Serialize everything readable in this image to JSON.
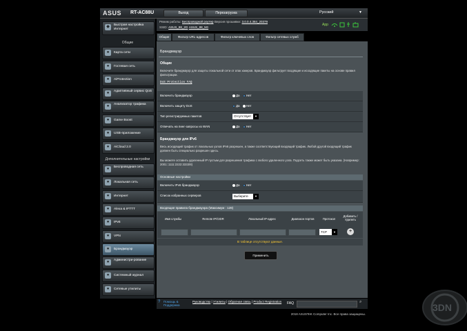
{
  "header": {
    "brand": "ASUS",
    "model": "RT-AC88U",
    "logout_label": "Выход",
    "reboot_label": "Перезагрузка",
    "language": "Русский"
  },
  "info": {
    "mode_label": "Режим работы:",
    "mode_value": "Беспроводной роутер",
    "firmware_label": "Версия прошивки:",
    "firmware_value": "3.0.0.4.384_20379",
    "ssid_label": "SSID:",
    "ssid_1": "ASUS_88_2G",
    "ssid_2": "ASUS_88_5G",
    "app_label": "App"
  },
  "sidebar": {
    "quick_setup": "Быстрая настройка Интернет",
    "general_heading": "Общие",
    "general_items": [
      {
        "label": "Карта сети",
        "icon": "network-map-icon"
      },
      {
        "label": "Гостевая сеть",
        "icon": "guest-network-icon"
      },
      {
        "label": "AiProtection",
        "icon": "aiprotection-icon"
      },
      {
        "label": "Адаптивный сервис QoS",
        "icon": "qos-icon"
      },
      {
        "label": "Анализатор трафика",
        "icon": "traffic-analyzer-icon"
      },
      {
        "label": "Game Boost",
        "icon": "game-boost-icon"
      },
      {
        "label": "USB-приложение",
        "icon": "usb-icon"
      },
      {
        "label": "AiCloud 2.0",
        "icon": "cloud-icon"
      }
    ],
    "advanced_heading": "Дополнительные настройки",
    "advanced_items": [
      {
        "label": "Беспроводная сеть",
        "icon": "wireless-icon"
      },
      {
        "label": "Локальная сеть",
        "icon": "lan-icon"
      },
      {
        "label": "Интернет",
        "icon": "wan-icon"
      },
      {
        "label": "Alexa & IFTTT",
        "icon": "alexa-icon"
      },
      {
        "label": "IPv6",
        "icon": "ipv6-icon"
      },
      {
        "label": "VPN",
        "icon": "vpn-icon"
      },
      {
        "label": "Брандмауэр",
        "icon": "firewall-icon",
        "active": true
      },
      {
        "label": "Администри-рование",
        "icon": "admin-icon"
      },
      {
        "label": "Системный журнал",
        "icon": "syslog-icon"
      },
      {
        "label": "Сетевые утилиты",
        "icon": "network-tools-icon"
      }
    ]
  },
  "tabs": [
    "Общие",
    "Фильтр URL-адресов",
    "Фильтр ключевых слов",
    "Фильтр сетевых служб"
  ],
  "main": {
    "title": "Брандмауэр",
    "general_heading": "Общие",
    "intro": "Включите брандмауэр для защиты локальной сети от атак хакеров. Брандмауэр фильтрует входящие и исходящие пакеты на основе правил фильтрации.",
    "dos_faq": "DoS Protection FAQ",
    "rows": [
      {
        "label": "Включить брандмауэр",
        "type": "radio",
        "yes": "Да",
        "no": "Нет",
        "selected": "no"
      },
      {
        "label": "Включить защиту DoS",
        "type": "radio",
        "yes": "Да",
        "no": "Нет",
        "selected": "yes"
      },
      {
        "label": "Тип регистрируемых пакетов",
        "type": "select",
        "value": "Отсутствует"
      },
      {
        "label": "Отвечать на пинг-запросы из WAN",
        "type": "radio",
        "yes": "Да",
        "no": "Нет",
        "selected": "no"
      }
    ],
    "ipv6_heading": "Брандмауэр для IPv6",
    "ipv6_para1": "Весь исходящий трафик от локальных узлов IPv6 разрешен, а также соответствующий входящий трафик. Любой другой входящий трафик должен быть специально разрешен здесь.",
    "ipv6_para2": "Вы можете оставить удаленный IP пустым для разрешения трафика с любого удаленного узла. Подсеть также может быть указана. (Например: 2001::1111:2222:3333/8)",
    "basic_heading": "Основные настройки",
    "basic_rows": [
      {
        "label": "Включить IPv6 брандмауэр",
        "type": "radio",
        "yes": "Да",
        "no": "Нет",
        "selected": "no"
      },
      {
        "label": "Список избранных серверов",
        "type": "select",
        "value": "Выберите"
      }
    ],
    "rules_heading": "Входящие правила брандмауэра (Максимум : 128)",
    "rules_columns": [
      "Имя службы",
      "Remote IP/CIDR",
      "Локальный IP-адрес",
      "Диапазон портов",
      "Протокол",
      "Добавить / Удалить"
    ],
    "protocol_value": "TCP",
    "empty_message": "В таблице отсутствуют данные.",
    "apply_label": "Применить"
  },
  "footer": {
    "help_label": "Помощь & Поддержка",
    "links": [
      "Руководство",
      "Утилиты",
      "Обратная связь",
      "Product Registration"
    ],
    "faq_label": "FAQ",
    "copyright": "2018 ASUSTeK Computer Inc. Все права защищены."
  }
}
